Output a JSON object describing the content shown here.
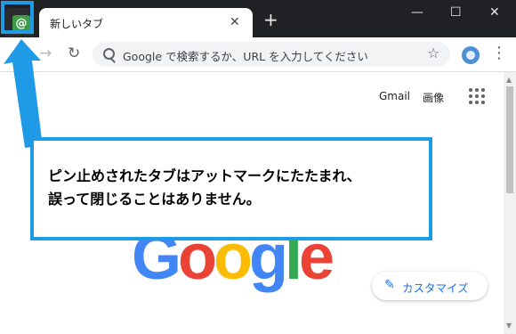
{
  "browser": {
    "pinned_tab_favicon": "@",
    "tab_title": "新しいタブ",
    "tab_close": "✕",
    "new_tab": "+",
    "window_min": "—",
    "window_max": "☐",
    "window_close": "✕",
    "back": "←",
    "forward": "→",
    "reload": "↻",
    "omnibox_placeholder": "Google で検索するか、URL を入力してください",
    "star": "☆",
    "menu": "⋮"
  },
  "page": {
    "gmail": "Gmail",
    "images": "画像",
    "logo": [
      "G",
      "o",
      "o",
      "g",
      "l",
      "e"
    ],
    "logo_colors": [
      "#4285f4",
      "#ea4335",
      "#fbbc05",
      "#4285f4",
      "#34a853",
      "#ea4335"
    ],
    "customize_label": "カスタマイズ",
    "pencil": "✎"
  },
  "annotation": {
    "line1": "ピン止めされたタブはアットマークにたたまれ、",
    "line2": "誤って閉じることはありません。",
    "accent_color": "#1e9ae6"
  },
  "colors": {
    "titlebar": "#202124",
    "accent_blue": "#1a73e8"
  }
}
